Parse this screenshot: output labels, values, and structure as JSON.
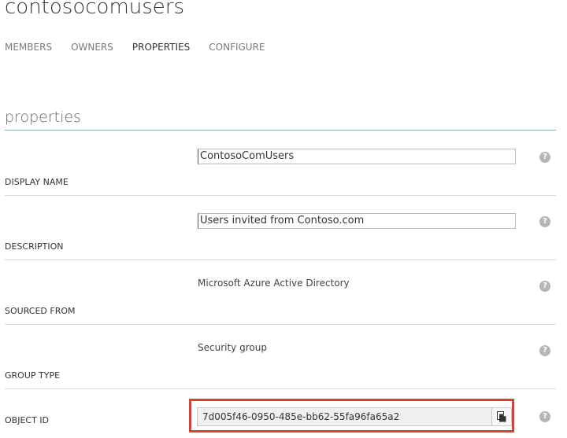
{
  "header": {
    "title": "contosocomusers"
  },
  "tabs": [
    {
      "label": "MEMBERS",
      "active": false
    },
    {
      "label": "OWNERS",
      "active": false
    },
    {
      "label": "PROPERTIES",
      "active": true
    },
    {
      "label": "CONFIGURE",
      "active": false
    }
  ],
  "section": {
    "title": "properties"
  },
  "fields": {
    "display_name": {
      "label": "DISPLAY NAME",
      "value": "ContosoComUsers"
    },
    "description": {
      "label": "DESCRIPTION",
      "value": "Users invited from Contoso.com"
    },
    "sourced_from": {
      "label": "SOURCED FROM",
      "value": "Microsoft Azure Active Directory"
    },
    "group_type": {
      "label": "GROUP TYPE",
      "value": "Security group"
    },
    "object_id": {
      "label": "OBJECT ID",
      "value": "7d005f46-0950-485e-bb62-55fa96fa65a2"
    }
  },
  "icons": {
    "help": "question-mark-icon",
    "copy": "copy-icon"
  },
  "colors": {
    "highlight": "#e03a3a",
    "section_underline": "#7ab0c6"
  }
}
